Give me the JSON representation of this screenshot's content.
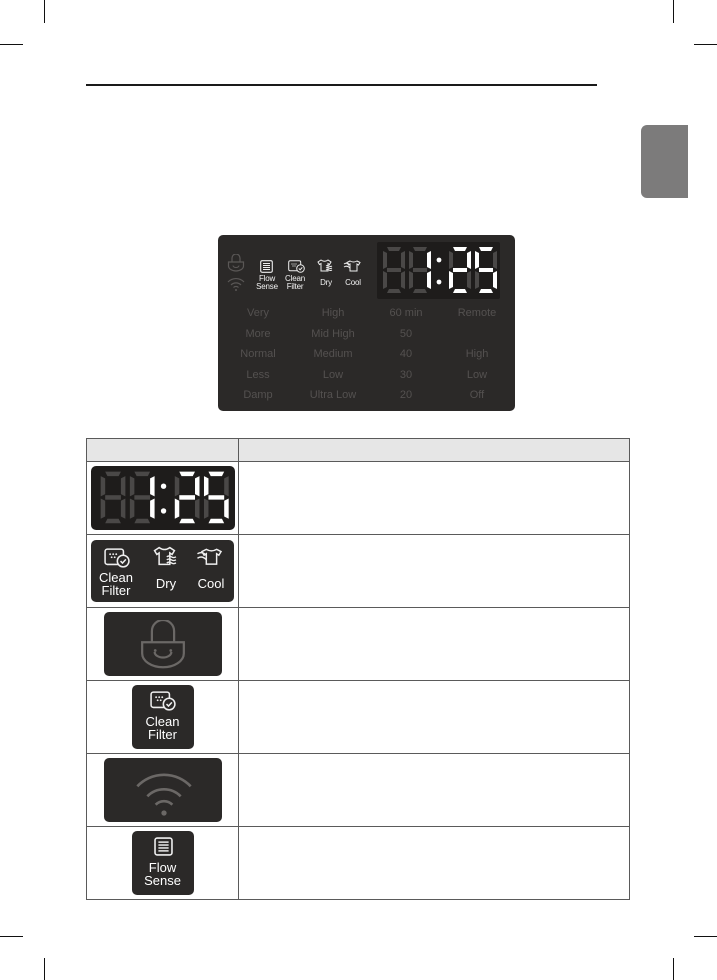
{
  "page": {
    "side_tab_color": "#7c7b7b"
  },
  "control_panel": {
    "icons": [
      {
        "name": "child-lock",
        "label": ""
      },
      {
        "name": "wifi",
        "label": ""
      },
      {
        "name": "flow-sense",
        "label_line1": "Flow",
        "label_line2": "Sense"
      },
      {
        "name": "clean-filter",
        "label_line1": "Clean",
        "label_line2": "Filter"
      },
      {
        "name": "dry",
        "label_line1": "Dry",
        "label_line2": ""
      },
      {
        "name": "cool",
        "label_line1": "Cool",
        "label_line2": ""
      }
    ],
    "display_time": "1:25",
    "columns": {
      "dryness": [
        "Very",
        "More",
        "Normal",
        "Less",
        "Damp"
      ],
      "temp": [
        "High",
        "Mid High",
        "Medium",
        "Low",
        "Ultra Low"
      ],
      "time": [
        "60 min",
        "50",
        "40",
        "30",
        "20"
      ],
      "other": [
        "Remote",
        "",
        "High",
        "Low",
        "Off"
      ]
    }
  },
  "table": {
    "header": {
      "col1": "",
      "col2": ""
    },
    "rows": [
      {
        "icon": "time-display",
        "label": "",
        "description": "",
        "time": "1:25"
      },
      {
        "icon": "status-icons",
        "labels": {
          "clean1": "Clean",
          "clean2": "Filter",
          "dry": "Dry",
          "cool": "Cool"
        },
        "description": ""
      },
      {
        "icon": "child-lock-icon",
        "description": ""
      },
      {
        "icon": "clean-filter-icon",
        "label_line1": "Clean",
        "label_line2": "Filter",
        "description": ""
      },
      {
        "icon": "wifi-icon",
        "description": ""
      },
      {
        "icon": "flow-sense-icon",
        "label_line1": "Flow",
        "label_line2": "Sense",
        "description": ""
      }
    ]
  }
}
